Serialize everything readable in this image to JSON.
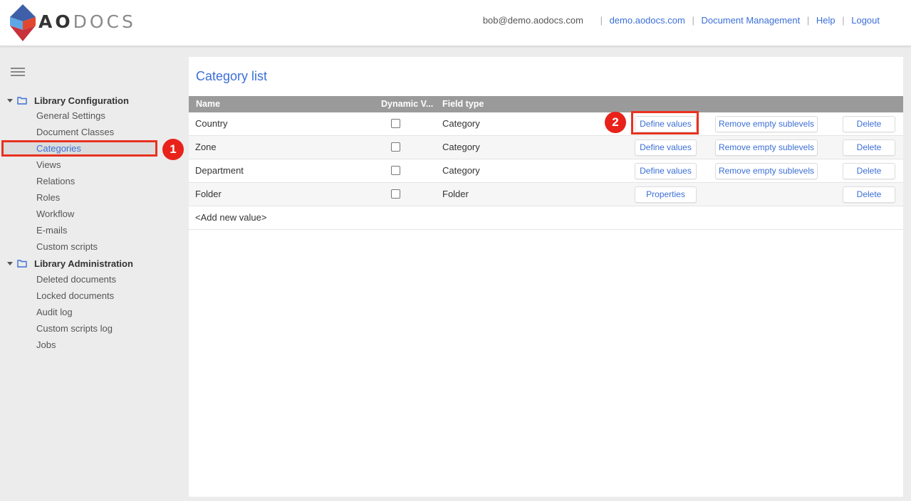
{
  "header": {
    "logo_text_bold": "AO",
    "logo_text_light": "DOCS",
    "email": "bob@demo.aodocs.com",
    "links": [
      "demo.aodocs.com",
      "Document Management",
      "Help",
      "Logout"
    ]
  },
  "sidebar": {
    "sections": [
      {
        "title": "Library Configuration",
        "items": [
          "General Settings",
          "Document Classes",
          "Categories",
          "Views",
          "Relations",
          "Roles",
          "Workflow",
          "E-mails",
          "Custom scripts"
        ]
      },
      {
        "title": "Library Administration",
        "items": [
          "Deleted documents",
          "Locked documents",
          "Audit log",
          "Custom scripts log",
          "Jobs"
        ]
      }
    ],
    "active_item": "Categories"
  },
  "annotations": [
    "1",
    "2"
  ],
  "main": {
    "title": "Category list",
    "columns": [
      "Name",
      "Dynamic V...",
      "Field type"
    ],
    "rows": [
      {
        "name": "Country",
        "field_type": "Category",
        "buttons": [
          "Define values",
          "Remove empty sublevels",
          "Delete"
        ]
      },
      {
        "name": "Zone",
        "field_type": "Category",
        "buttons": [
          "Define values",
          "Remove empty sublevels",
          "Delete"
        ]
      },
      {
        "name": "Department",
        "field_type": "Category",
        "buttons": [
          "Define values",
          "Remove empty sublevels",
          "Delete"
        ]
      },
      {
        "name": "Folder",
        "field_type": "Folder",
        "buttons": [
          "Properties",
          "Delete"
        ]
      }
    ],
    "add_new": "<Add new value>"
  },
  "colors": {
    "accent": "#3b6fd6",
    "annotation": "#e8221a",
    "header_row": "#9a9a9a"
  }
}
